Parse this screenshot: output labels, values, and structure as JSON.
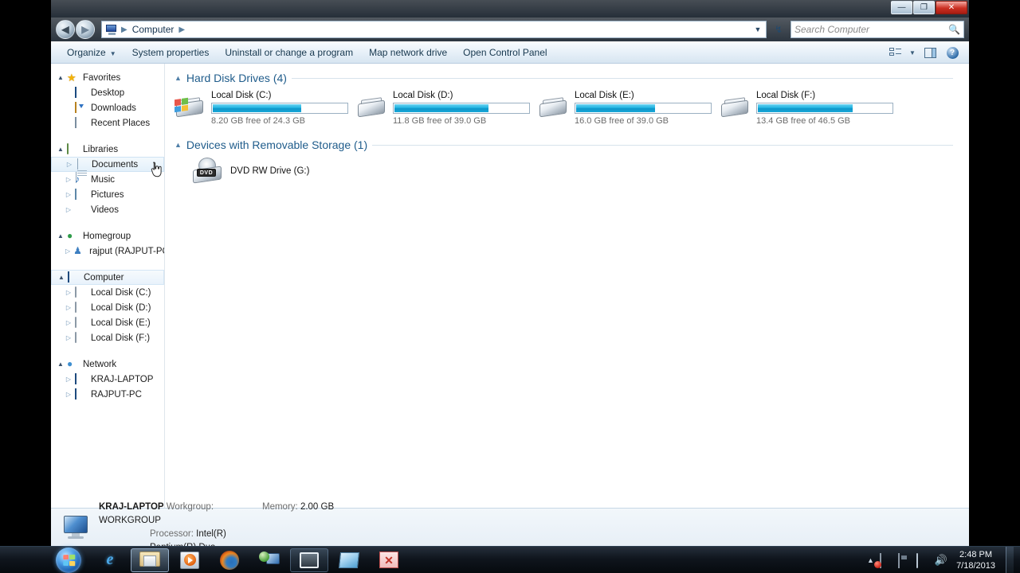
{
  "window": {
    "title_buttons": {
      "minimize": "—",
      "maximize": "❐",
      "close": "✕"
    }
  },
  "addressbar": {
    "back_icon": "◀",
    "forward_icon": "▶",
    "crumb_icon": "computer-icon",
    "path_root": "Computer",
    "sep": "▶",
    "dropdown": "▼",
    "refresh": "↯",
    "search_placeholder": "Search Computer",
    "search_value": "",
    "search_icon": "search-icon"
  },
  "commandbar": {
    "items": [
      {
        "label": "Organize",
        "has_caret": true
      },
      {
        "label": "System properties",
        "has_caret": false
      },
      {
        "label": "Uninstall or change a program",
        "has_caret": false
      },
      {
        "label": "Map network drive",
        "has_caret": false
      },
      {
        "label": "Open Control Panel",
        "has_caret": false
      }
    ],
    "caret": "▼",
    "view_icon": "change-view-icon",
    "view_caret": "▼",
    "preview_icon": "preview-pane-icon",
    "help_icon": "help-icon",
    "help_glyph": "?"
  },
  "navpane": {
    "groups": [
      {
        "header": {
          "label": "Favorites",
          "icon": "star-icon",
          "expander": "▲"
        },
        "items": [
          {
            "label": "Desktop",
            "icon": "desktop-icon",
            "expander": ""
          },
          {
            "label": "Downloads",
            "icon": "downloads-icon",
            "expander": ""
          },
          {
            "label": "Recent Places",
            "icon": "recent-places-icon",
            "expander": ""
          }
        ]
      },
      {
        "header": {
          "label": "Libraries",
          "icon": "libraries-icon",
          "expander": "▲"
        },
        "items": [
          {
            "label": "Documents",
            "icon": "document-icon",
            "expander": "▷",
            "hover": true
          },
          {
            "label": "Music",
            "icon": "music-icon",
            "expander": "▷"
          },
          {
            "label": "Pictures",
            "icon": "pictures-icon",
            "expander": "▷"
          },
          {
            "label": "Videos",
            "icon": "videos-icon",
            "expander": "▷"
          }
        ]
      },
      {
        "header": {
          "label": "Homegroup",
          "icon": "homegroup-icon",
          "expander": "▲"
        },
        "items": [
          {
            "label": "rajput (RAJPUT-PC)",
            "icon": "user-icon",
            "expander": "▷"
          }
        ]
      },
      {
        "header": {
          "label": "Computer",
          "icon": "computer-icon",
          "expander": "▲",
          "selected": true
        },
        "items": [
          {
            "label": "Local Disk (C:)",
            "icon": "windows-drive-icon",
            "expander": "▷"
          },
          {
            "label": "Local Disk (D:)",
            "icon": "drive-icon",
            "expander": "▷"
          },
          {
            "label": "Local Disk (E:)",
            "icon": "drive-icon",
            "expander": "▷"
          },
          {
            "label": "Local Disk (F:)",
            "icon": "drive-icon",
            "expander": "▷"
          }
        ]
      },
      {
        "header": {
          "label": "Network",
          "icon": "network-icon",
          "expander": "▲"
        },
        "items": [
          {
            "label": "KRAJ-LAPTOP",
            "icon": "computer-icon",
            "expander": "▷"
          },
          {
            "label": "RAJPUT-PC",
            "icon": "computer-icon",
            "expander": "▷"
          }
        ]
      }
    ]
  },
  "content": {
    "groups": [
      {
        "title": "Hard Disk Drives (4)",
        "expander": "▲",
        "drives": [
          {
            "name": "Local Disk (C:)",
            "free_text": "8.20 GB free of 24.3 GB",
            "used_percent": 66,
            "icon": "windows-drive-icon"
          },
          {
            "name": "Local Disk (D:)",
            "free_text": "11.8 GB free of 39.0 GB",
            "used_percent": 70,
            "icon": "drive-icon"
          },
          {
            "name": "Local Disk (E:)",
            "free_text": "16.0 GB free of 39.0 GB",
            "used_percent": 59,
            "icon": "drive-icon"
          },
          {
            "name": "Local Disk (F:)",
            "free_text": "13.4 GB free of 46.5 GB",
            "used_percent": 71,
            "icon": "drive-icon"
          }
        ]
      },
      {
        "title": "Devices with Removable Storage (1)",
        "expander": "▲",
        "devices": [
          {
            "name": "DVD RW Drive (G:)",
            "icon": "dvd-drive-icon",
            "label": "DVD"
          }
        ]
      }
    ]
  },
  "statusbar": {
    "icon": "computer-icon",
    "computer_name": "KRAJ-LAPTOP",
    "workgroup_label": "Workgroup:",
    "workgroup_value": "WORKGROUP",
    "memory_label": "Memory:",
    "memory_value": "2.00 GB",
    "processor_label": "Processor:",
    "processor_value": "Intel(R) Pentium(R) Dua..."
  },
  "taskbar": {
    "start_icon": "windows-start-orb",
    "buttons": [
      {
        "name": "internet-explorer",
        "glyph": "e"
      },
      {
        "name": "windows-explorer",
        "glyph": ""
      },
      {
        "name": "windows-media-player",
        "glyph": ""
      },
      {
        "name": "firefox",
        "glyph": ""
      },
      {
        "name": "network-computer-app",
        "glyph": ""
      },
      {
        "name": "white-frame-app",
        "glyph": ""
      },
      {
        "name": "blue-app",
        "glyph": ""
      },
      {
        "name": "red-chart-app",
        "glyph": "✕"
      }
    ],
    "tray": {
      "arrow": "▲",
      "icons": [
        "action-center-flag-icon",
        "removable-media-icon",
        "network-icon",
        "volume-icon"
      ],
      "volume_glyph": "🔊",
      "time": "2:48 PM",
      "date": "7/18/2013"
    }
  }
}
